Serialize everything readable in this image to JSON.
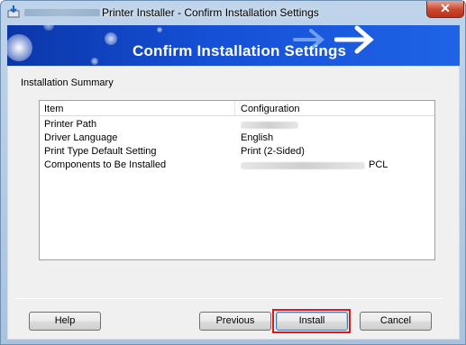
{
  "window": {
    "title": "Printer Installer - Confirm Installation Settings",
    "close_label": "✕"
  },
  "banner": {
    "title": "Confirm Installation Settings"
  },
  "summary": {
    "label": "Installation Summary",
    "columns": [
      "Item",
      "Configuration"
    ],
    "rows": [
      {
        "item": "Printer Path",
        "config": ""
      },
      {
        "item": "Driver Language",
        "config": "English"
      },
      {
        "item": "Print Type Default Setting",
        "config": "Print (2-Sided)"
      },
      {
        "item": "Components to Be Installed",
        "config": "PCL"
      }
    ]
  },
  "buttons": {
    "help": "Help",
    "previous": "Previous",
    "install": "Install",
    "cancel": "Cancel"
  },
  "colors": {
    "banner": "#1550d6",
    "highlight": "#e0161b"
  }
}
